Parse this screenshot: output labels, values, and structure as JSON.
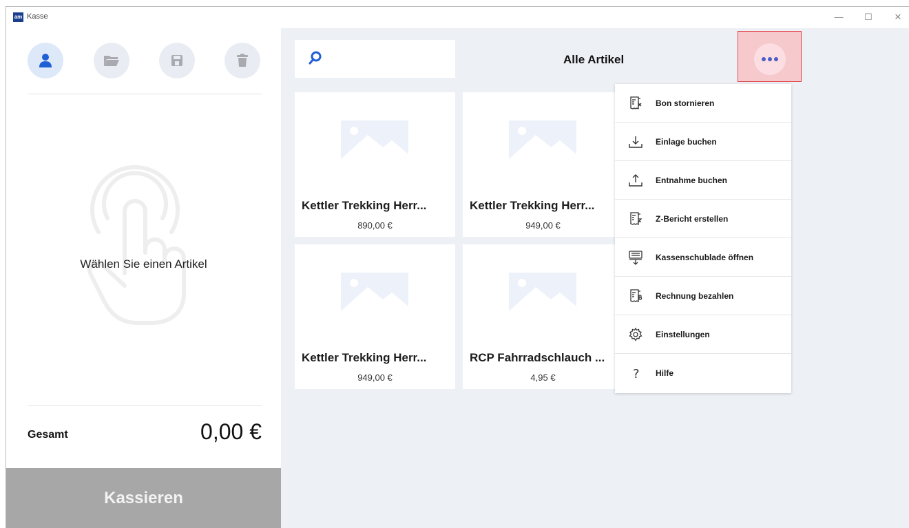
{
  "window": {
    "logo_text": "am",
    "title": "Kasse",
    "minimize": "—",
    "maximize": "☐",
    "close": "✕"
  },
  "sidebar": {
    "icons": [
      "user-icon",
      "folder-icon",
      "save-icon",
      "trash-icon"
    ],
    "empty_text": "Wählen Sie einen Artikel",
    "total_label": "Gesamt",
    "total_value": "0,00 €",
    "checkout_label": "Kassieren"
  },
  "main": {
    "search_placeholder": "",
    "category_title": "Alle Artikel",
    "products": [
      {
        "name": "Kettler Trekking  Herr...",
        "price": "890,00 €"
      },
      {
        "name": "Kettler Trekking  Herr...",
        "price": "949,00 €"
      },
      {
        "name": "Kettler Trekking  Herr...",
        "price": "949,00 €"
      },
      {
        "name": "RCP Fahrradschlauch ...",
        "price": "4,95 €"
      }
    ]
  },
  "menu": {
    "items": [
      {
        "label": "Bon stornieren",
        "icon": "receipt-cancel-icon"
      },
      {
        "label": "Einlage buchen",
        "icon": "deposit-icon"
      },
      {
        "label": "Entnahme buchen",
        "icon": "withdraw-icon"
      },
      {
        "label": "Z-Bericht erstellen",
        "icon": "z-report-icon"
      },
      {
        "label": "Kassenschublade öffnen",
        "icon": "cash-drawer-icon"
      },
      {
        "label": "Rechnung bezahlen",
        "icon": "invoice-icon"
      },
      {
        "label": "Einstellungen",
        "icon": "gear-icon"
      },
      {
        "label": "Hilfe",
        "icon": "help-icon"
      }
    ]
  },
  "colors": {
    "accent": "#1f5fd6",
    "more_highlight": "#e0464c",
    "checkout_bg": "#a7a7a7",
    "main_bg": "#edf0f5"
  }
}
